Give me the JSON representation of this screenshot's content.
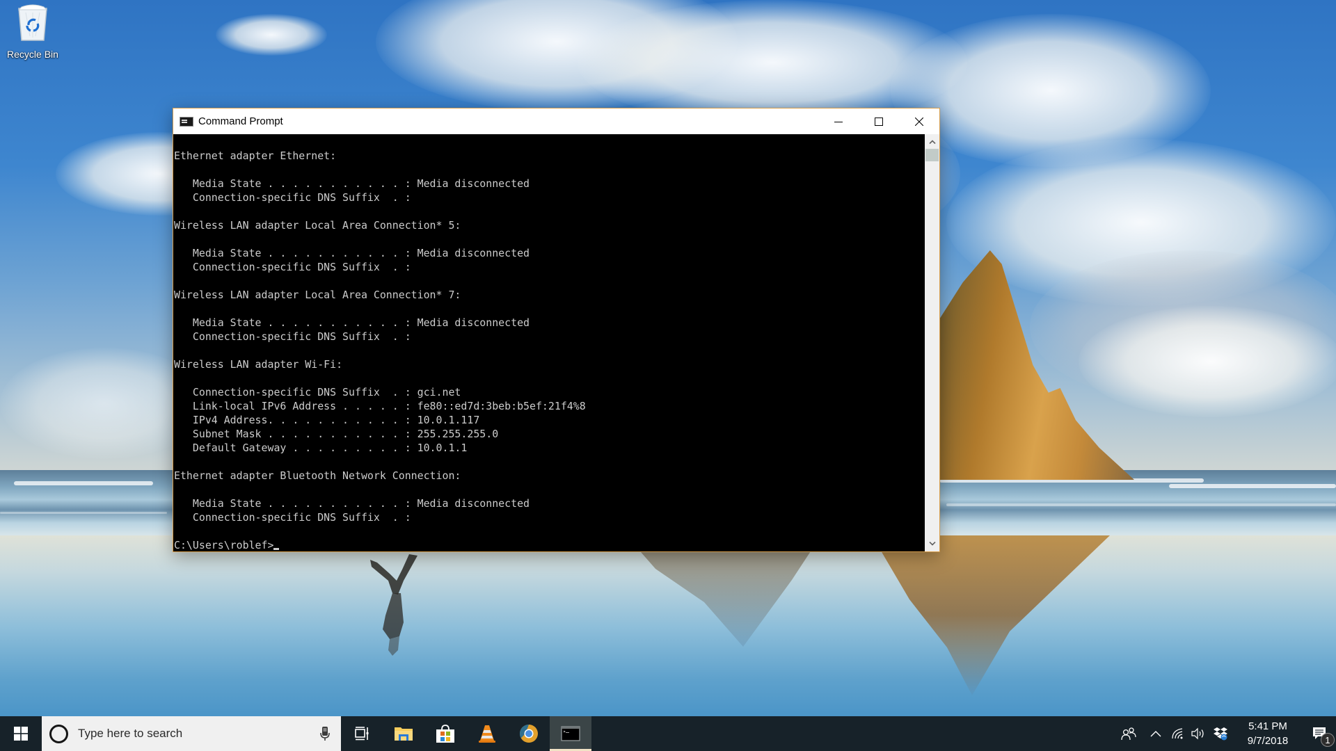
{
  "desktop": {
    "icons": [
      {
        "label": "Recycle Bin",
        "icon": "recycle-bin-icon"
      }
    ]
  },
  "window": {
    "title": "Command Prompt",
    "icon": "cmd-icon",
    "controls": {
      "minimize": "minimize-icon",
      "maximize": "maximize-icon",
      "close": "close-icon"
    },
    "console_lines": [
      "Ethernet adapter Ethernet:",
      "",
      "   Media State . . . . . . . . . . . : Media disconnected",
      "   Connection-specific DNS Suffix  . :",
      "",
      "Wireless LAN adapter Local Area Connection* 5:",
      "",
      "   Media State . . . . . . . . . . . : Media disconnected",
      "   Connection-specific DNS Suffix  . :",
      "",
      "Wireless LAN adapter Local Area Connection* 7:",
      "",
      "   Media State . . . . . . . . . . . : Media disconnected",
      "   Connection-specific DNS Suffix  . :",
      "",
      "Wireless LAN adapter Wi-Fi:",
      "",
      "   Connection-specific DNS Suffix  . : gci.net",
      "   Link-local IPv6 Address . . . . . : fe80::ed7d:3beb:b5ef:21f4%8",
      "   IPv4 Address. . . . . . . . . . . : 10.0.1.117",
      "   Subnet Mask . . . . . . . . . . . : 255.255.255.0",
      "   Default Gateway . . . . . . . . . : 10.0.1.1",
      "",
      "Ethernet adapter Bluetooth Network Connection:",
      "",
      "   Media State . . . . . . . . . . . : Media disconnected",
      "   Connection-specific DNS Suffix  . :",
      ""
    ],
    "prompt": "C:\\Users\\roblef>"
  },
  "taskbar": {
    "search_placeholder": "Type here to search",
    "apps": [
      {
        "name": "task-view",
        "icon": "task-view-icon",
        "active": false
      },
      {
        "name": "file-explorer",
        "icon": "folder-icon",
        "active": false
      },
      {
        "name": "microsoft-store",
        "icon": "store-icon",
        "active": false
      },
      {
        "name": "vlc",
        "icon": "vlc-cone-icon",
        "active": false
      },
      {
        "name": "chrome",
        "icon": "chrome-icon",
        "active": false
      },
      {
        "name": "command-prompt",
        "icon": "cmd-icon",
        "active": true
      }
    ],
    "tray": {
      "icons": [
        "people-icon",
        "chevron-up-icon",
        "wifi-icon",
        "volume-icon",
        "dropbox-icon"
      ],
      "time": "5:41 PM",
      "date": "9/7/2018",
      "notification_count": "1"
    }
  }
}
